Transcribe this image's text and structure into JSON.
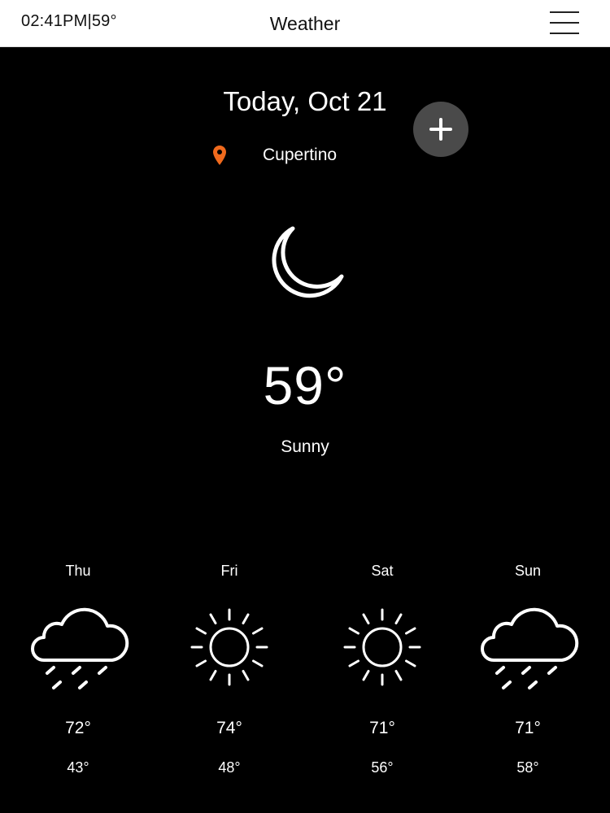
{
  "status_bar": {
    "time_temp": "02:41PM|59°"
  },
  "header": {
    "title": "Weather",
    "menu_icon": "hamburger-menu-icon"
  },
  "main": {
    "date": "Today, Oct 21",
    "add_icon": "plus-icon",
    "location": {
      "icon": "location-pin-icon",
      "label": "Cupertino"
    },
    "current": {
      "icon": "moon-icon",
      "temperature": "59°",
      "condition": "Sunny"
    }
  },
  "forecast": [
    {
      "day": "Thu",
      "icon": "rain-cloud-icon",
      "high": "72°",
      "low": "43°"
    },
    {
      "day": "Fri",
      "icon": "sun-icon",
      "high": "74°",
      "low": "48°"
    },
    {
      "day": "Sat",
      "icon": "sun-icon",
      "high": "71°",
      "low": "56°"
    },
    {
      "day": "Sun",
      "icon": "rain-cloud-icon",
      "high": "71°",
      "low": "58°"
    }
  ],
  "colors": {
    "background": "#000000",
    "header_bg": "#ffffff",
    "pin_accent": "#f06a1d",
    "add_button_bg": "#4a4a4a"
  }
}
